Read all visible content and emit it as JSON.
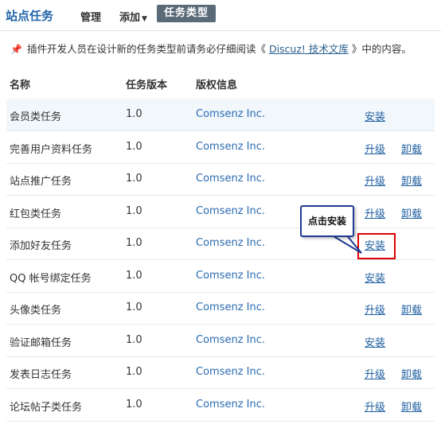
{
  "header": {
    "title": "站点任务",
    "nav": [
      {
        "label": "管理"
      },
      {
        "label": "添加"
      },
      {
        "label": "任务类型"
      }
    ]
  },
  "notice": {
    "text_before": "插件开发人员在设计新的任务类型前请务必仔细阅读《 ",
    "link": "Discuz! 技术文库",
    "text_after": " 》中的内容。"
  },
  "table": {
    "headers": [
      "名称",
      "任务版本",
      "版权信息"
    ],
    "rows": [
      {
        "name": "会员类任务",
        "version": "1.0",
        "copyright": "Comsenz Inc.",
        "action1": "安装",
        "action2": ""
      },
      {
        "name": "完善用户资料任务",
        "version": "1.0",
        "copyright": "Comsenz Inc.",
        "action1": "升级",
        "action2": "卸载"
      },
      {
        "name": "站点推广任务",
        "version": "1.0",
        "copyright": "Comsenz Inc.",
        "action1": "升级",
        "action2": "卸载"
      },
      {
        "name": "红包类任务",
        "version": "1.0",
        "copyright": "Comsenz Inc.",
        "action1": "升级",
        "action2": "卸载"
      },
      {
        "name": "添加好友任务",
        "version": "1.0",
        "copyright": "Comsenz Inc.",
        "action1": "安装",
        "action2": ""
      },
      {
        "name": "QQ 帐号绑定任务",
        "version": "1.0",
        "copyright": "Comsenz Inc.",
        "action1": "安装",
        "action2": ""
      },
      {
        "name": "头像类任务",
        "version": "1.0",
        "copyright": "Comsenz Inc.",
        "action1": "升级",
        "action2": "卸载"
      },
      {
        "name": "验证邮箱任务",
        "version": "1.0",
        "copyright": "Comsenz Inc.",
        "action1": "安装",
        "action2": ""
      },
      {
        "name": "发表日志任务",
        "version": "1.0",
        "copyright": "Comsenz Inc.",
        "action1": "升级",
        "action2": "卸载"
      },
      {
        "name": "论坛帖子类任务",
        "version": "1.0",
        "copyright": "Comsenz Inc.",
        "action1": "升级",
        "action2": "卸载"
      }
    ]
  },
  "annotation": {
    "callout_text": "点击安装",
    "highlight_color": "#e00000",
    "callout_border_color": "#1f3a93"
  },
  "colors": {
    "brand": "#2366a8",
    "link": "#1f5fa0",
    "active_tab_bg": "#5a6a78",
    "row_highlight": "#f2f7fc"
  }
}
